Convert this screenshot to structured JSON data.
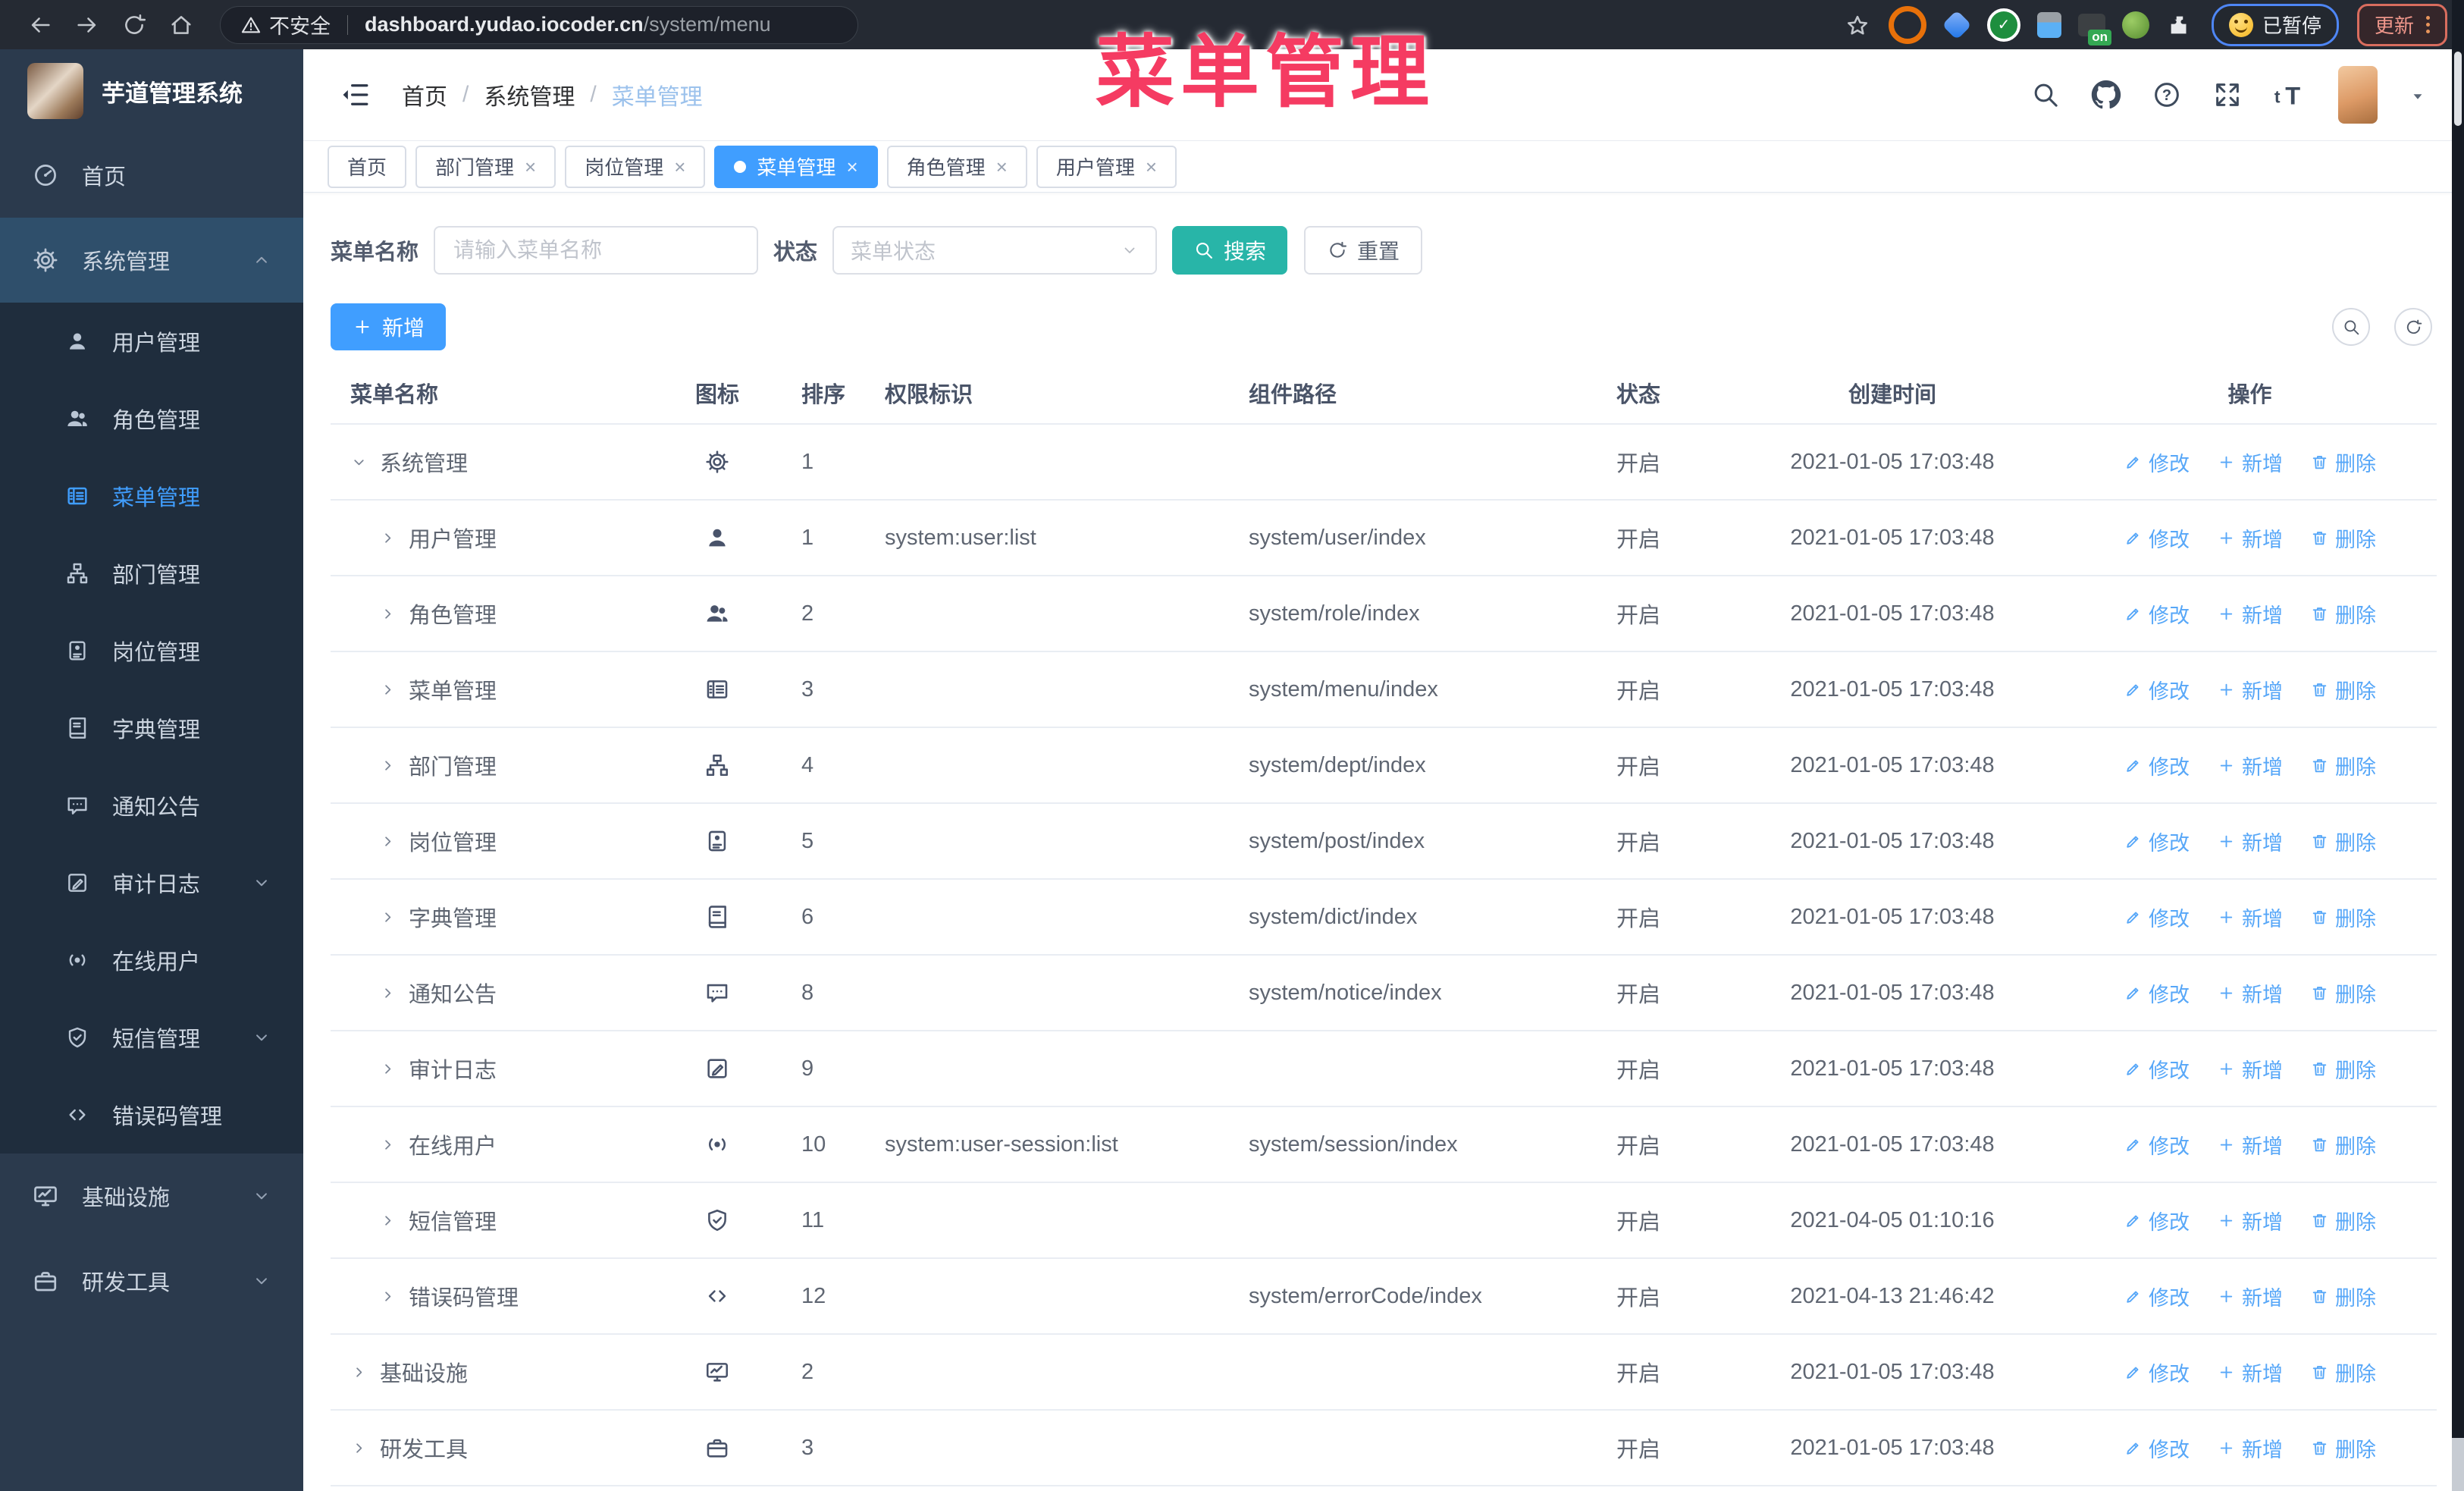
{
  "colors": {
    "primary": "#409eff",
    "teal": "#28b5a8",
    "annotation_red": "#f53b62",
    "link_blue": "#57a7f8",
    "sidebar_bg": "#2b3a4d",
    "submenu_bg": "#1f2d3d",
    "active_parent_bg": "#2f4f6b"
  },
  "browser": {
    "security_label": "不安全",
    "url_host": "dashboard.yudao.iocoder.cn",
    "url_path": "/system/menu",
    "extensions": [
      {
        "key": "orange-circle"
      },
      {
        "key": "blue-gem"
      },
      {
        "key": "green-check"
      },
      {
        "key": "grid-blue"
      },
      {
        "key": "dark-on",
        "badge": "on"
      },
      {
        "key": "green-monkey"
      },
      {
        "key": "puzzle-white"
      }
    ],
    "paused_badge": "已暂停",
    "update_label": "更新"
  },
  "annotation": {
    "text": "菜单管理"
  },
  "sidebar": {
    "logo_title": "芋道管理系统",
    "sections": [
      {
        "type": "item",
        "key": "home",
        "label": "首页",
        "icon": "dashboard"
      },
      {
        "type": "group",
        "key": "system",
        "label": "系统管理",
        "icon": "gear",
        "expanded": true,
        "children": [
          {
            "key": "user",
            "label": "用户管理",
            "icon": "user"
          },
          {
            "key": "role",
            "label": "角色管理",
            "icon": "users"
          },
          {
            "key": "menu",
            "label": "菜单管理",
            "icon": "menu",
            "active": true
          },
          {
            "key": "dept",
            "label": "部门管理",
            "icon": "tree"
          },
          {
            "key": "post",
            "label": "岗位管理",
            "icon": "post"
          },
          {
            "key": "dict",
            "label": "字典管理",
            "icon": "dict"
          },
          {
            "key": "notice",
            "label": "通知公告",
            "icon": "message"
          },
          {
            "key": "auditlog",
            "label": "审计日志",
            "icon": "log",
            "chevron": "down"
          },
          {
            "key": "online",
            "label": "在线用户",
            "icon": "online"
          },
          {
            "key": "sms",
            "label": "短信管理",
            "icon": "shield",
            "chevron": "down"
          },
          {
            "key": "errcode",
            "label": "错误码管理",
            "icon": "code"
          }
        ]
      },
      {
        "type": "item",
        "key": "infra",
        "label": "基础设施",
        "icon": "monitor",
        "chevron": "down"
      },
      {
        "type": "item",
        "key": "tools",
        "label": "研发工具",
        "icon": "tool",
        "chevron": "down"
      }
    ]
  },
  "header": {
    "breadcrumb": [
      "首页",
      "系统管理",
      "菜单管理"
    ],
    "font_size_icon_text": "tT",
    "help_glyph": "?"
  },
  "tabs": [
    {
      "key": "home",
      "label": "首页",
      "closable": false
    },
    {
      "key": "dept",
      "label": "部门管理",
      "closable": true
    },
    {
      "key": "post",
      "label": "岗位管理",
      "closable": true
    },
    {
      "key": "menu",
      "label": "菜单管理",
      "closable": true,
      "active": true
    },
    {
      "key": "role",
      "label": "角色管理",
      "closable": true
    },
    {
      "key": "user",
      "label": "用户管理",
      "closable": true
    }
  ],
  "filters": {
    "name_label": "菜单名称",
    "name_placeholder": "请输入菜单名称",
    "status_label": "状态",
    "status_placeholder": "菜单状态",
    "search_label": "搜索",
    "reset_label": "重置"
  },
  "toolbar": {
    "add_label": "新增"
  },
  "table": {
    "columns": [
      "菜单名称",
      "图标",
      "排序",
      "权限标识",
      "组件路径",
      "状态",
      "创建时间",
      "操作"
    ],
    "actions": {
      "edit": "修改",
      "add": "新增",
      "delete": "删除"
    },
    "rows": [
      {
        "name": "系统管理",
        "level": 0,
        "expanded": true,
        "icon": "gear",
        "sort": "1",
        "perms": "",
        "path": "",
        "status": "开启",
        "time": "2021-01-05 17:03:48"
      },
      {
        "name": "用户管理",
        "level": 1,
        "icon": "user",
        "sort": "1",
        "perms": "system:user:list",
        "path": "system/user/index",
        "status": "开启",
        "time": "2021-01-05 17:03:48"
      },
      {
        "name": "角色管理",
        "level": 1,
        "icon": "users",
        "sort": "2",
        "perms": "",
        "path": "system/role/index",
        "status": "开启",
        "time": "2021-01-05 17:03:48"
      },
      {
        "name": "菜单管理",
        "level": 1,
        "icon": "menu",
        "sort": "3",
        "perms": "",
        "path": "system/menu/index",
        "status": "开启",
        "time": "2021-01-05 17:03:48"
      },
      {
        "name": "部门管理",
        "level": 1,
        "icon": "tree",
        "sort": "4",
        "perms": "",
        "path": "system/dept/index",
        "status": "开启",
        "time": "2021-01-05 17:03:48"
      },
      {
        "name": "岗位管理",
        "level": 1,
        "icon": "post",
        "sort": "5",
        "perms": "",
        "path": "system/post/index",
        "status": "开启",
        "time": "2021-01-05 17:03:48"
      },
      {
        "name": "字典管理",
        "level": 1,
        "icon": "dict",
        "sort": "6",
        "perms": "",
        "path": "system/dict/index",
        "status": "开启",
        "time": "2021-01-05 17:03:48"
      },
      {
        "name": "通知公告",
        "level": 1,
        "icon": "message",
        "sort": "8",
        "perms": "",
        "path": "system/notice/index",
        "status": "开启",
        "time": "2021-01-05 17:03:48"
      },
      {
        "name": "审计日志",
        "level": 1,
        "icon": "log",
        "sort": "9",
        "perms": "",
        "path": "",
        "status": "开启",
        "time": "2021-01-05 17:03:48"
      },
      {
        "name": "在线用户",
        "level": 1,
        "icon": "online",
        "sort": "10",
        "perms": "system:user-session:list",
        "path": "system/session/index",
        "status": "开启",
        "time": "2021-01-05 17:03:48"
      },
      {
        "name": "短信管理",
        "level": 1,
        "icon": "shield",
        "sort": "11",
        "perms": "",
        "path": "",
        "status": "开启",
        "time": "2021-04-05 01:10:16"
      },
      {
        "name": "错误码管理",
        "level": 1,
        "icon": "code",
        "sort": "12",
        "perms": "",
        "path": "system/errorCode/index",
        "status": "开启",
        "time": "2021-04-13 21:46:42"
      },
      {
        "name": "基础设施",
        "level": 0,
        "expanded": false,
        "icon": "monitor",
        "sort": "2",
        "perms": "",
        "path": "",
        "status": "开启",
        "time": "2021-01-05 17:03:48"
      },
      {
        "name": "研发工具",
        "level": 0,
        "expanded": false,
        "icon": "tool",
        "sort": "3",
        "perms": "",
        "path": "",
        "status": "开启",
        "time": "2021-01-05 17:03:48"
      }
    ]
  }
}
